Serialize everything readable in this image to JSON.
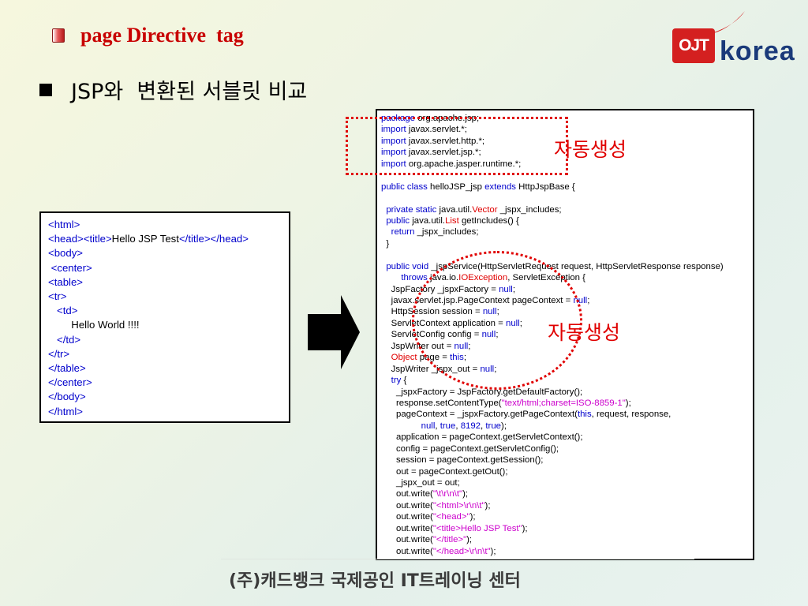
{
  "slide": {
    "title": "page Directive  tag",
    "heading": "JSP와  변환된 서블릿 비교",
    "footer": "(주)캐드뱅크 국제공인 IT트레이닝 센터"
  },
  "logo": {
    "box_text": "OJT",
    "text": "korea"
  },
  "annotations": {
    "label_top": "자동생성",
    "label_middle": "자동생성"
  },
  "html_code": [
    [
      {
        "t": "<html>",
        "c": "tag"
      }
    ],
    [
      {
        "t": "<head><title>",
        "c": "tag"
      },
      {
        "t": "Hello JSP Test"
      },
      {
        "t": "</title></head>",
        "c": "tag"
      }
    ],
    [
      {
        "t": "<body>",
        "c": "tag"
      }
    ],
    [
      {
        "t": " <center>",
        "c": "tag"
      }
    ],
    [
      {
        "t": "<table>",
        "c": "tag"
      }
    ],
    [
      {
        "t": "<tr>",
        "c": "tag"
      }
    ],
    [
      {
        "t": "   <td>",
        "c": "tag"
      }
    ],
    [
      {
        "t": "        Hello World !!!!"
      }
    ],
    [
      {
        "t": "   </td>",
        "c": "tag"
      }
    ],
    [
      {
        "t": "</tr>",
        "c": "tag"
      }
    ],
    [
      {
        "t": "</table>",
        "c": "tag"
      }
    ],
    [
      {
        "t": "</center>",
        "c": "tag"
      }
    ],
    [
      {
        "t": "</body>",
        "c": "tag"
      }
    ],
    [
      {
        "t": "</html>",
        "c": "tag"
      }
    ]
  ],
  "java_code": [
    [
      {
        "t": "package",
        "c": "kw"
      },
      {
        "t": " org.apache.jsp;"
      }
    ],
    [
      {
        "t": "import",
        "c": "kw"
      },
      {
        "t": " javax.servlet.*;"
      }
    ],
    [
      {
        "t": "import",
        "c": "kw"
      },
      {
        "t": " javax.servlet.http.*;"
      }
    ],
    [
      {
        "t": "import",
        "c": "kw"
      },
      {
        "t": " javax.servlet.jsp.*;"
      }
    ],
    [
      {
        "t": "import",
        "c": "kw"
      },
      {
        "t": " org.apache.jasper.runtime.*;"
      }
    ],
    [],
    [
      {
        "t": "public class",
        "c": "kw"
      },
      {
        "t": " helloJSP_jsp "
      },
      {
        "t": "extends",
        "c": "kw"
      },
      {
        "t": " HttpJspBase {"
      }
    ],
    [],
    [
      {
        "t": "  "
      },
      {
        "t": "private static",
        "c": "kw"
      },
      {
        "t": " java.util."
      },
      {
        "t": "Vector",
        "c": "err"
      },
      {
        "t": " _jspx_includes;"
      }
    ],
    [
      {
        "t": "  "
      },
      {
        "t": "public",
        "c": "kw"
      },
      {
        "t": " java.util."
      },
      {
        "t": "List",
        "c": "err"
      },
      {
        "t": " getIncludes() {"
      }
    ],
    [
      {
        "t": "    "
      },
      {
        "t": "return",
        "c": "kw"
      },
      {
        "t": " _jspx_includes;"
      }
    ],
    [
      {
        "t": "  }"
      }
    ],
    [],
    [
      {
        "t": "  "
      },
      {
        "t": "public void",
        "c": "kw"
      },
      {
        "t": " _jspService(HttpServletRequest request, HttpServletResponse response)"
      }
    ],
    [
      {
        "t": "        "
      },
      {
        "t": "throws",
        "c": "kw"
      },
      {
        "t": " java.io."
      },
      {
        "t": "IOException",
        "c": "err"
      },
      {
        "t": ", ServletException {"
      }
    ],
    [
      {
        "t": "    JspFactory _jspxFactory = "
      },
      {
        "t": "null",
        "c": "kw"
      },
      {
        "t": ";"
      }
    ],
    [
      {
        "t": "    javax.servlet.jsp.PageContext pageContext = "
      },
      {
        "t": "null",
        "c": "kw"
      },
      {
        "t": ";"
      }
    ],
    [
      {
        "t": "    HttpSession session = "
      },
      {
        "t": "null",
        "c": "kw"
      },
      {
        "t": ";"
      }
    ],
    [
      {
        "t": "    ServletContext application = "
      },
      {
        "t": "null",
        "c": "kw"
      },
      {
        "t": ";"
      }
    ],
    [
      {
        "t": "    ServletConfig config = "
      },
      {
        "t": "null",
        "c": "kw"
      },
      {
        "t": ";"
      }
    ],
    [
      {
        "t": "    JspWriter out = "
      },
      {
        "t": "null",
        "c": "kw"
      },
      {
        "t": ";"
      }
    ],
    [
      {
        "t": "    "
      },
      {
        "t": "Object",
        "c": "err"
      },
      {
        "t": " page = "
      },
      {
        "t": "this",
        "c": "kw"
      },
      {
        "t": ";"
      }
    ],
    [
      {
        "t": "    JspWriter _jspx_out = "
      },
      {
        "t": "null",
        "c": "kw"
      },
      {
        "t": ";"
      }
    ],
    [
      {
        "t": "    "
      },
      {
        "t": "try",
        "c": "kw"
      },
      {
        "t": " {"
      }
    ],
    [
      {
        "t": "      _jspxFactory = JspFactory.getDefaultFactory();"
      }
    ],
    [
      {
        "t": "      response.setContentType("
      },
      {
        "t": "\"text/html;charset=ISO-8859-1\"",
        "c": "str"
      },
      {
        "t": ");"
      }
    ],
    [
      {
        "t": "      pageContext = _jspxFactory.getPageContext("
      },
      {
        "t": "this",
        "c": "kw"
      },
      {
        "t": ", request, response,"
      }
    ],
    [
      {
        "t": "                "
      },
      {
        "t": "null",
        "c": "kw"
      },
      {
        "t": ", "
      },
      {
        "t": "true",
        "c": "kw"
      },
      {
        "t": ", "
      },
      {
        "t": "8192",
        "c": "kw"
      },
      {
        "t": ", "
      },
      {
        "t": "true",
        "c": "kw"
      },
      {
        "t": ");"
      }
    ],
    [
      {
        "t": "      application = pageContext.getServletContext();"
      }
    ],
    [
      {
        "t": "      config = pageContext.getServletConfig();"
      }
    ],
    [
      {
        "t": "      session = pageContext.getSession();"
      }
    ],
    [
      {
        "t": "      out = pageContext.getOut();"
      }
    ],
    [
      {
        "t": "      _jspx_out = out;"
      }
    ],
    [
      {
        "t": "      out.write("
      },
      {
        "t": "\"\\t\\r\\n\\t\"",
        "c": "str"
      },
      {
        "t": ");"
      }
    ],
    [
      {
        "t": "      out.write("
      },
      {
        "t": "\"<html>\\r\\n\\t\"",
        "c": "str"
      },
      {
        "t": ");"
      }
    ],
    [
      {
        "t": "      out.write("
      },
      {
        "t": "\"<head>\"",
        "c": "str"
      },
      {
        "t": ");"
      }
    ],
    [
      {
        "t": "      out.write("
      },
      {
        "t": "\"<title>Hello JSP Test\"",
        "c": "str"
      },
      {
        "t": ");"
      }
    ],
    [
      {
        "t": "      out.write("
      },
      {
        "t": "\"</title>\"",
        "c": "str"
      },
      {
        "t": ");"
      }
    ],
    [
      {
        "t": "      out.write("
      },
      {
        "t": "\"</head>\\r\\n\\t\"",
        "c": "str"
      },
      {
        "t": ");"
      }
    ]
  ],
  "colors": {
    "title": "#c80000",
    "html_tag": "#0000cc",
    "java_keyword": "#0000cc",
    "java_type_red": "#e00000",
    "java_string": "#cc00cc",
    "annotation": "#e00000"
  },
  "icons": [
    "slide-bullet-icon",
    "heading-square-bullet-icon",
    "right-arrow-icon",
    "ojt-korea-logo"
  ]
}
